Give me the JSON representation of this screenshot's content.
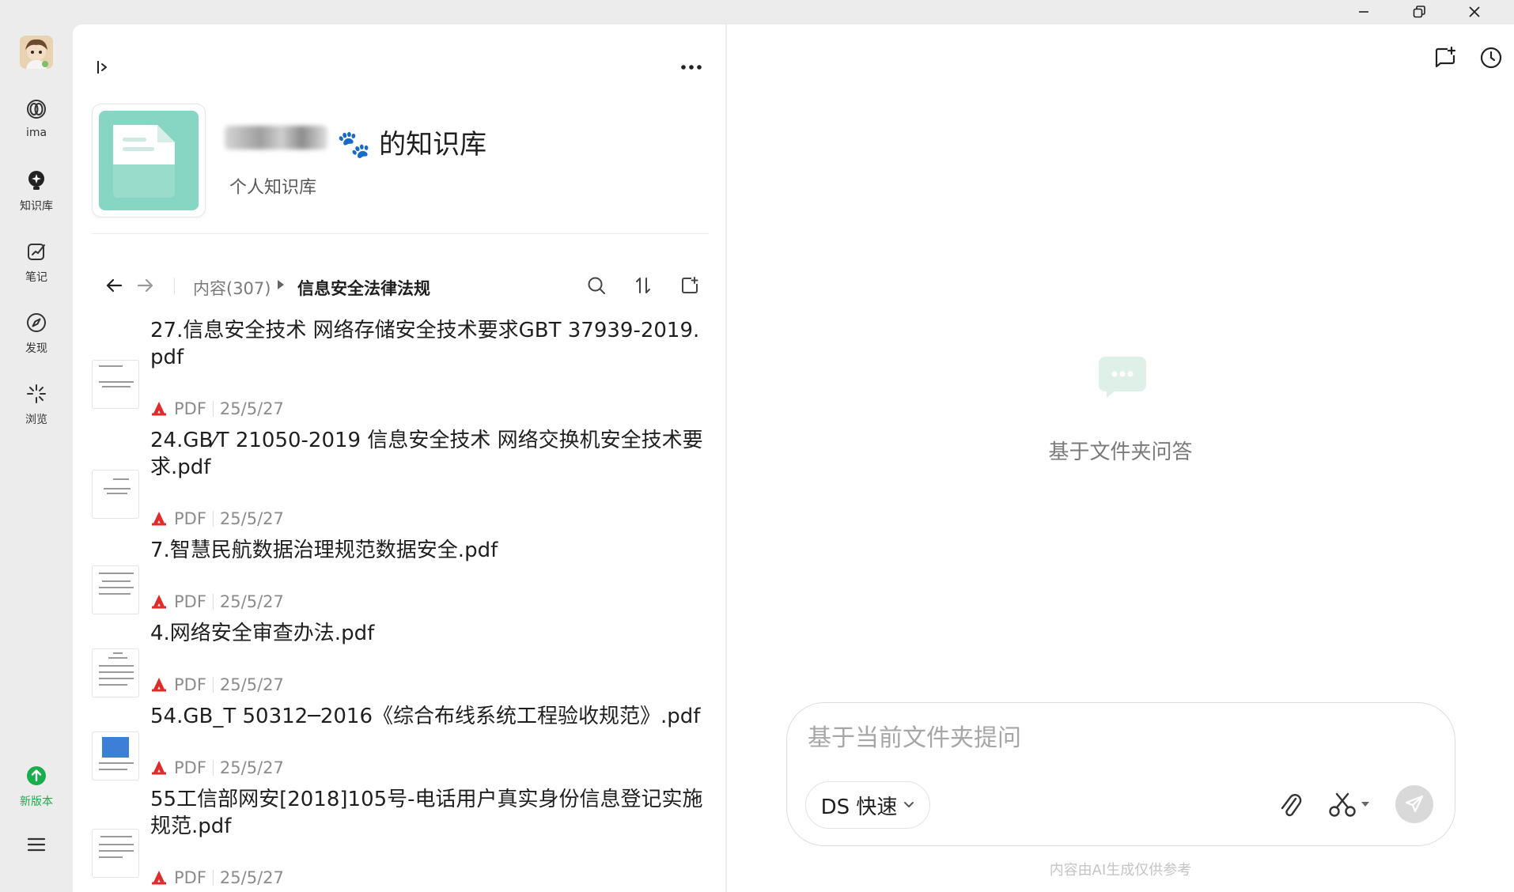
{
  "nav": {
    "items": [
      {
        "label": "ima",
        "icon": "ima-logo-icon"
      },
      {
        "label": "知识库",
        "icon": "knowledge-base-icon"
      },
      {
        "label": "笔记",
        "icon": "note-icon"
      },
      {
        "label": "发现",
        "icon": "compass-icon"
      },
      {
        "label": "浏览",
        "icon": "sparkle-icon"
      }
    ],
    "update_label": "新版本"
  },
  "kb": {
    "title": "🐾 的知识库",
    "subtitle": "个人知识库"
  },
  "breadcrumb": {
    "root": "内容(307)",
    "current": "信息安全法律法规"
  },
  "files": [
    {
      "name": "27.信息安全技术 网络存储安全技术要求GBT 37939-2019.pdf",
      "type": "PDF",
      "date": "25/5/27"
    },
    {
      "name": "24.GB⁄T 21050-2019 信息安全技术 网络交换机安全技术要求.pdf",
      "type": "PDF",
      "date": "25/5/27"
    },
    {
      "name": "7.智慧民航数据治理规范数据安全.pdf",
      "type": "PDF",
      "date": "25/5/27"
    },
    {
      "name": "4.网络安全审查办法.pdf",
      "type": "PDF",
      "date": "25/5/27"
    },
    {
      "name": "54.GB_T 50312─2016《综合布线系统工程验收规范》.pdf",
      "type": "PDF",
      "date": "25/5/27"
    },
    {
      "name": "55工信部网安[2018]105号-电话用户真实身份信息登记实施规范.pdf",
      "type": "PDF",
      "date": "25/5/27"
    }
  ],
  "chat": {
    "empty_text": "基于文件夹问答",
    "input_placeholder": "基于当前文件夹提问",
    "model_label": "DS 快速",
    "disclaimer": "内容由AI生成仅供参考"
  },
  "colors": {
    "accent_green": "#1aad4b",
    "kb_cover": "#87d6c3",
    "pdf_red": "#e02b2b"
  }
}
